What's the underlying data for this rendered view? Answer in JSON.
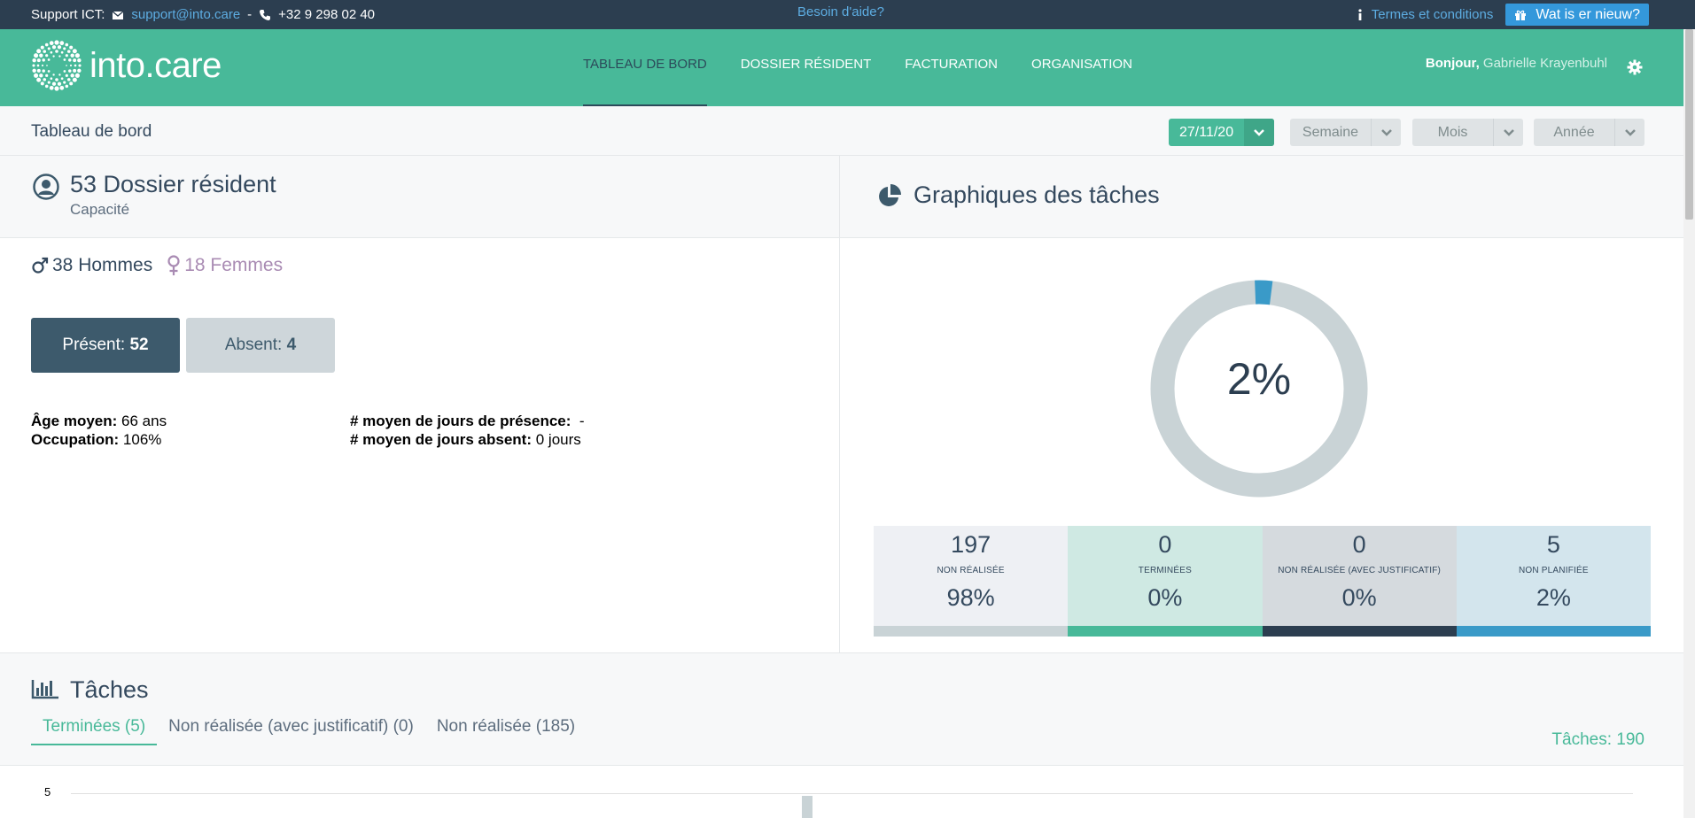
{
  "topbar": {
    "support_label": "Support ICT:",
    "email": "support@into.care",
    "separator": "-",
    "phone": "+32 9 298 02 40",
    "help": "Besoin d'aide?",
    "terms": "Termes et conditions",
    "whats_new": "Wat is er nieuw?"
  },
  "nav": {
    "logo_text": "into.care",
    "items": [
      "TABLEAU DE BORD",
      "DOSSIER RÉSIDENT",
      "FACTURATION",
      "ORGANISATION"
    ],
    "greeting": "Bonjour,",
    "user_name": "Gabrielle Krayenbuhl"
  },
  "subheader": {
    "title": "Tableau de bord",
    "date": "27/11/20",
    "week": "Semaine",
    "month": "Mois",
    "year": "Année"
  },
  "residents": {
    "title": "53 Dossier résident",
    "subtitle": "Capacité",
    "men": "38 Hommes",
    "women": "18 Femmes",
    "present_label": "Présent:",
    "present_value": "52",
    "absent_label": "Absent:",
    "absent_value": "4",
    "avg_age_label": "Âge moyen:",
    "avg_age_value": "66 ans",
    "occupation_label": "Occupation:",
    "occupation_value": "106%",
    "avg_presence_label": "# moyen de jours de présence:",
    "avg_presence_value": "-",
    "avg_absent_label": "# moyen de jours absent:",
    "avg_absent_value": "0 jours"
  },
  "task_chart": {
    "title": "Graphiques des tâches",
    "center_label": "2%",
    "fraction_done": 0.02,
    "colors": {
      "track": "#c9d3d6",
      "segment": "#3a9ac8"
    },
    "tiles": [
      {
        "value": "197",
        "label": "NON RÉALISÉE",
        "percent": "98%",
        "bg": "#eef0f4",
        "bar": "#c9d3d6"
      },
      {
        "value": "0",
        "label": "TERMINÉES",
        "percent": "0%",
        "bg": "#cfe9e3",
        "bar": "#48b999"
      },
      {
        "value": "0",
        "label": "NON RÉALISÉE (AVEC JUSTIFICATIF)",
        "percent": "0%",
        "bg": "#d5dade",
        "bar": "#2c3e50"
      },
      {
        "value": "5",
        "label": "NON PLANIFIÉE",
        "percent": "2%",
        "bg": "#d3e5ed",
        "bar": "#3a9ac8"
      }
    ]
  },
  "tasks": {
    "title": "Tâches",
    "tabs": [
      "Terminées (5)",
      "Non réalisée (avec justificatif) (0)",
      "Non réalisée (185)"
    ],
    "count": "Tâches: 190",
    "y_tick_top": "5"
  }
}
